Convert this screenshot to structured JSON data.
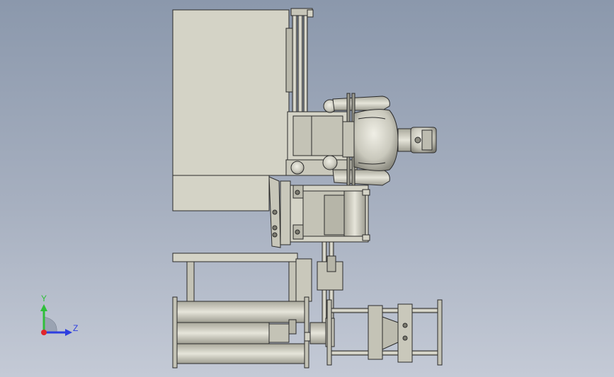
{
  "viewport": {
    "background_top": "#8b98ac",
    "background_bottom": "#c4cad6",
    "part_fill": "#d4d3c6",
    "part_shade": "#b9b8ab",
    "line_color": "#2b2b2b"
  },
  "triad": {
    "y_label": "Y",
    "z_label": "Z",
    "y_color": "#2fbf3a",
    "z_color": "#2d3ee0",
    "x_color": "#e0262b"
  }
}
